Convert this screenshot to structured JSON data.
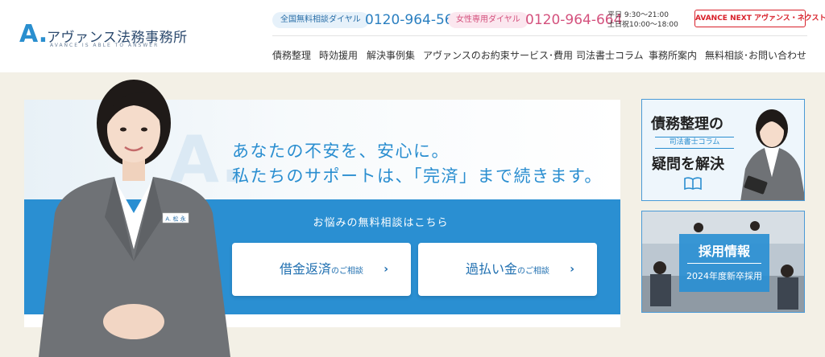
{
  "logo": {
    "mark": "A.",
    "name": "アヴァンス法務事務所",
    "tagline": "AVANCE IS ABLE TO ANSWER"
  },
  "contact": {
    "national_label": "全国無料相談ダイヤル",
    "national_phone": "0120-964-564",
    "women_label": "女性専用ダイヤル",
    "women_phone": "0120-964-664",
    "hours_weekday": "平日 9:30～21:00",
    "hours_weekend": "土日祝10:00～18:00",
    "advance_next_label": "AVANCE NEXT アヴァンス・ネクスト"
  },
  "nav": {
    "items": [
      "債務整理",
      "時効援用",
      "解決事例集",
      "アヴァンスのお約束",
      "サービス･費用",
      "司法書士コラム",
      "事務所案内",
      "無料相談･お問い合わせ"
    ]
  },
  "hero": {
    "headline_line1": "あなたの不安を、安心に。",
    "headline_line2": "私たちのサポートは、「完済」まで続きます。",
    "band_title": "お悩みの無料相談はこちら",
    "button1_main": "借金返済",
    "button1_sub": "のご相談",
    "button2_main": "過払い金",
    "button2_sub": "のご相談",
    "arrow": "›",
    "name_badge": "A. 松 永"
  },
  "side_banners": {
    "column_title1": "債務整理の",
    "column_sub": "司法書士コラム",
    "column_title2": "疑問を解決",
    "recruit_title": "採用情報",
    "recruit_sub": "2024年度新卒採用"
  },
  "colors": {
    "brand_blue": "#2a8fd2",
    "pink": "#d4517d",
    "advance_red": "#d8202a",
    "page_bg": "#f3f0e6"
  }
}
